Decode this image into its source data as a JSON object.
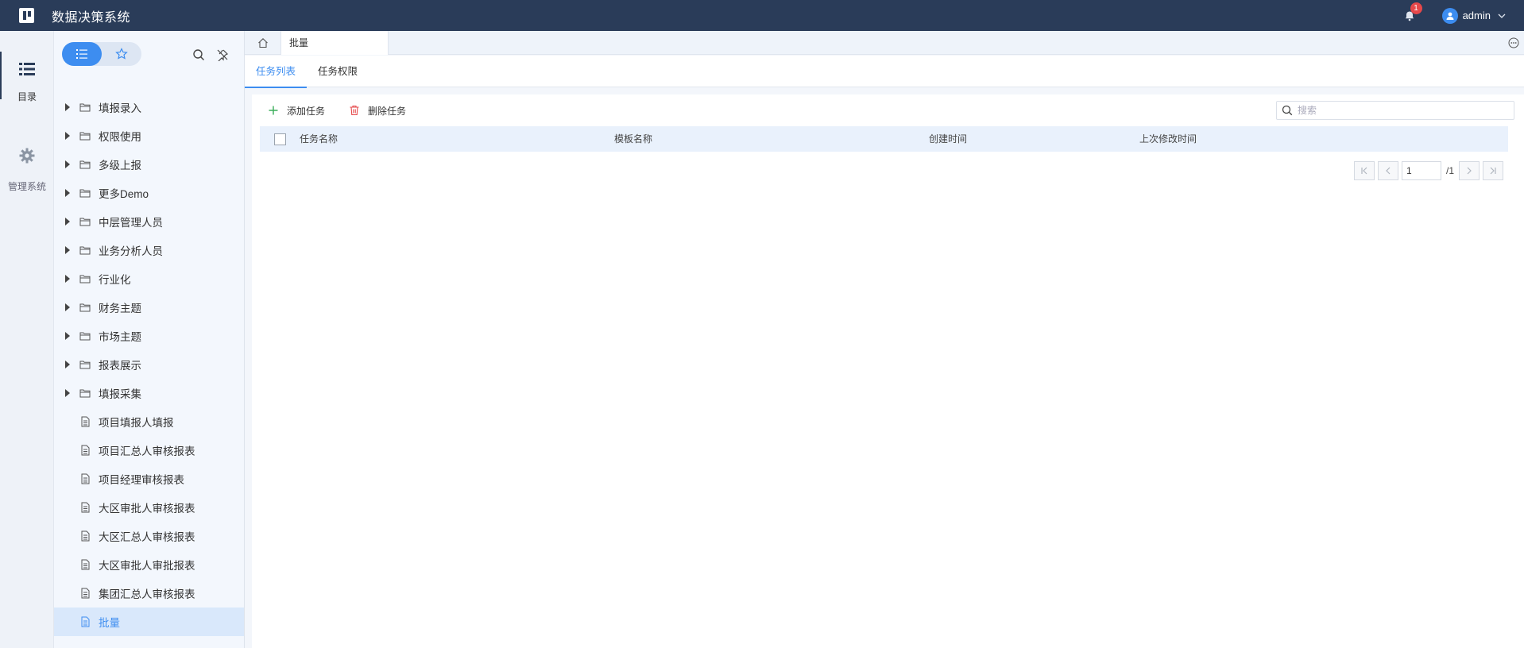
{
  "app": {
    "title": "数据决策系统"
  },
  "header": {
    "notification_count": "1",
    "username": "admin"
  },
  "rail": {
    "items": [
      {
        "label": "目录",
        "icon": "list-icon"
      },
      {
        "label": "管理系统",
        "icon": "gear-icon"
      }
    ]
  },
  "tree": {
    "items": [
      {
        "label": "填报录入",
        "type": "folder"
      },
      {
        "label": "权限使用",
        "type": "folder"
      },
      {
        "label": "多级上报",
        "type": "folder"
      },
      {
        "label": "更多Demo",
        "type": "folder"
      },
      {
        "label": "中层管理人员",
        "type": "folder"
      },
      {
        "label": "业务分析人员",
        "type": "folder"
      },
      {
        "label": "行业化",
        "type": "folder"
      },
      {
        "label": "财务主题",
        "type": "folder"
      },
      {
        "label": "市场主题",
        "type": "folder"
      },
      {
        "label": "报表展示",
        "type": "folder"
      },
      {
        "label": "填报采集",
        "type": "folder"
      },
      {
        "label": "项目填报人填报",
        "type": "file"
      },
      {
        "label": "项目汇总人审核报表",
        "type": "file"
      },
      {
        "label": "项目经理审核报表",
        "type": "file"
      },
      {
        "label": "大区审批人审核报表",
        "type": "file"
      },
      {
        "label": "大区汇总人审核报表",
        "type": "file"
      },
      {
        "label": "大区审批人审批报表",
        "type": "file"
      },
      {
        "label": "集团汇总人审核报表",
        "type": "file"
      },
      {
        "label": "批量",
        "type": "file",
        "selected": true
      }
    ]
  },
  "tabs": {
    "page_tab": "批量"
  },
  "subtabs": {
    "task_list": "任务列表",
    "task_permission": "任务权限"
  },
  "toolbar": {
    "add_label": "添加任务",
    "delete_label": "删除任务",
    "search_placeholder": "搜索"
  },
  "table": {
    "columns": [
      "任务名称",
      "模板名称",
      "创建时间",
      "上次修改时间"
    ]
  },
  "pager": {
    "current": "1",
    "total": "/1"
  },
  "colors": {
    "accent": "#3d8df0",
    "header_bg": "#2a3c59",
    "add_icon": "#3cae5a",
    "delete_icon": "#e6484a"
  }
}
